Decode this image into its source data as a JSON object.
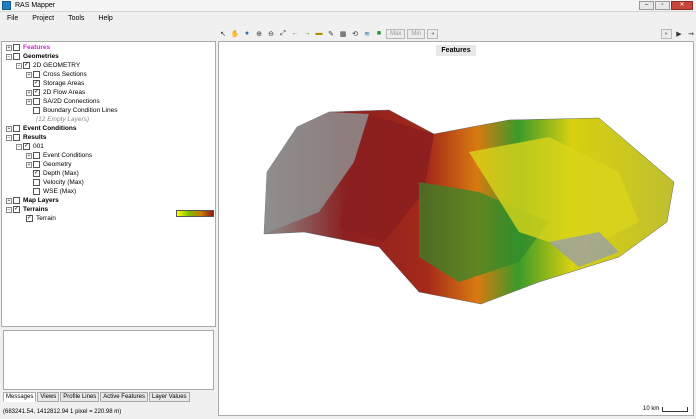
{
  "window": {
    "title": "RAS Mapper",
    "minimize": "–",
    "maximize": "▫",
    "close": "✕"
  },
  "menu": [
    "File",
    "Project",
    "Tools",
    "Help"
  ],
  "toolbar": {
    "max_label": "Max",
    "min_label": "Min"
  },
  "tree": {
    "features": "Features",
    "geometries": "Geometries",
    "geom_2d": "2D GEOMETRY",
    "cross_sections": "Cross Sections",
    "storage_areas": "Storage Areas",
    "flow_areas": "2D Flow Areas",
    "sa2d": "SA/2D Connections",
    "bc_lines": "Boundary Condition Lines",
    "empty_layers": "(12 Empty Layers)",
    "event_conditions": "Event Conditions",
    "results": "Results",
    "result_001": "001",
    "res_event_conditions": "Event Conditions",
    "res_geometry": "Geometry",
    "depth_max": "Depth (Max)",
    "velocity_max": "Velocity (Max)",
    "wse_max": "WSE (Max)",
    "map_layers": "Map Layers",
    "terrains": "Terrains",
    "terrain": "Terrain"
  },
  "bottom_tabs": [
    "Messages",
    "Views",
    "Profile Lines",
    "Active Features",
    "Layer Values"
  ],
  "map": {
    "title": "Features",
    "scale": "10 km"
  },
  "status": "(683241.54, 1412812.94   1 pixel = 220.98 m)"
}
